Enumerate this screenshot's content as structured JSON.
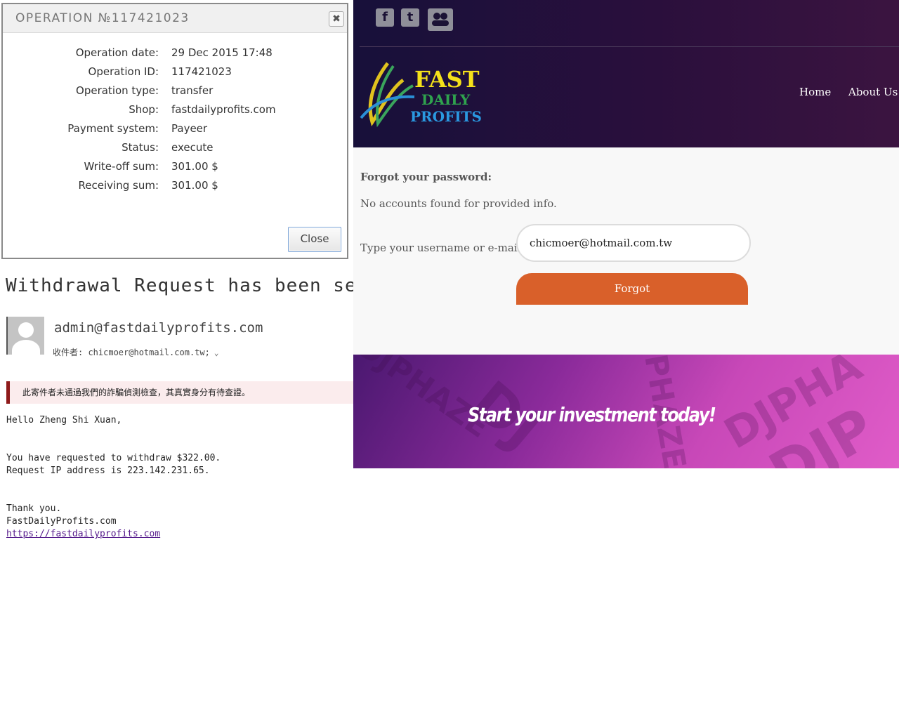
{
  "operation_dialog": {
    "title": "OPERATION №117421023",
    "close_x": "✖",
    "rows": [
      {
        "label": "Operation date:",
        "value": "29 Dec 2015 17:48"
      },
      {
        "label": "Operation ID:",
        "value": "117421023"
      },
      {
        "label": "Operation type:",
        "value": "transfer"
      },
      {
        "label": "Shop:",
        "value": "fastdailyprofits.com"
      },
      {
        "label": "Payment system:",
        "value": "Payeer"
      },
      {
        "label": "Status:",
        "value": "execute"
      },
      {
        "label": "Write-off sum:",
        "value": "301.00 $"
      },
      {
        "label": "Receiving sum:",
        "value": "301.00 $"
      }
    ],
    "close_button": "Close"
  },
  "email": {
    "subject": "Withdrawal Request has been sent",
    "sender": "admin@fastdailyprofits.com",
    "to_line": "收件者: chicmoer@hotmail.com.tw;",
    "warning": "此寄件者未通過我們的詐騙偵測檢查，其真實身分有待查證。",
    "body": "Hello Zheng Shi Xuan,\n\n\nYou have requested to withdraw $322.00.\nRequest IP address is 223.142.231.65.\n\n\nThank you.\nFastDailyProfits.com",
    "link": "https://fastdailyprofits.com"
  },
  "site": {
    "social_icons": [
      "facebook-icon",
      "twitter-icon",
      "community-icon"
    ],
    "logo": {
      "line1": "FAST",
      "line2": "DAILY",
      "line3": "PROFITS"
    },
    "nav": [
      "Home",
      "About Us"
    ],
    "forgot_title": "Forgot your password:",
    "message": "No accounts found for provided info.",
    "input_label": "Type your username or e-mail:",
    "input_value": "chicmoer@hotmail.com.tw",
    "button": "Forgot",
    "promo_text": "Start your investment today!",
    "colors": {
      "header": "#1e1040",
      "button": "#d9602a",
      "promo": "#b33fb0"
    }
  }
}
